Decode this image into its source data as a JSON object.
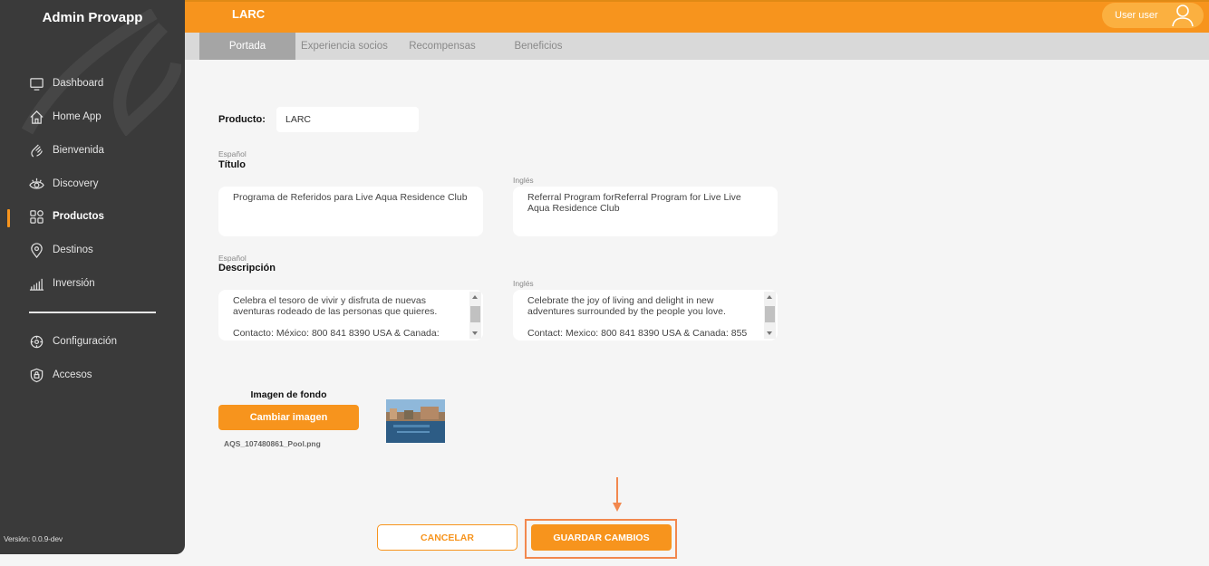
{
  "sidebar": {
    "brand": "Admin Provapp",
    "items": [
      {
        "label": "Dashboard",
        "icon": "monitor-icon"
      },
      {
        "label": "Home App",
        "icon": "home-icon"
      },
      {
        "label": "Bienvenida",
        "icon": "wave-hand-icon"
      },
      {
        "label": "Discovery",
        "icon": "eye-icon"
      },
      {
        "label": "Productos",
        "icon": "grid-icon",
        "active": true
      },
      {
        "label": "Destinos",
        "icon": "location-pin-icon"
      },
      {
        "label": "Inversión",
        "icon": "bar-chart-icon"
      }
    ],
    "secondary_items": [
      {
        "label": "Configuración",
        "icon": "gear-icon"
      },
      {
        "label": "Accesos",
        "icon": "shield-icon"
      }
    ],
    "version": "Versión: 0.0.9-dev"
  },
  "header": {
    "title": "LARC",
    "user_name": "User user",
    "accent_color": "#f7941d"
  },
  "tabs": [
    {
      "label": "Portada",
      "active": true
    },
    {
      "label": "Experiencia socios"
    },
    {
      "label": "Recompensas"
    },
    {
      "label": "Beneficios"
    }
  ],
  "form": {
    "product_label": "Producto:",
    "product_value": "LARC",
    "titulo": {
      "lang_es": "Español",
      "label": "Título",
      "lang_en": "Inglés",
      "value_es": "Programa de Referidos para Live Aqua Residence Club",
      "value_en": "Referral Program forReferral Program for Live Live Aqua Residence Club"
    },
    "descripcion": {
      "lang_es": "Español",
      "label": "Descripción",
      "lang_en": "Inglés",
      "value_es_1": "Celebra el tesoro de vivir y disfruta de nuevas aventuras rodeado de las personas que quieres.",
      "value_es_2": "Contacto: México: 800 841 8390 USA & Canada:",
      "value_en_1": "Celebrate the joy of living and delight in new adventures surrounded by the people you love.",
      "value_en_2": "Contact: Mexico: 800 841 8390 USA & Canada: 855"
    },
    "background": {
      "label": "Imagen de fondo",
      "button": "Cambiar imagen",
      "file_name": "AQS_107480861_Pool.png"
    }
  },
  "actions": {
    "cancel": "CANCELAR",
    "save": "GUARDAR CAMBIOS"
  }
}
